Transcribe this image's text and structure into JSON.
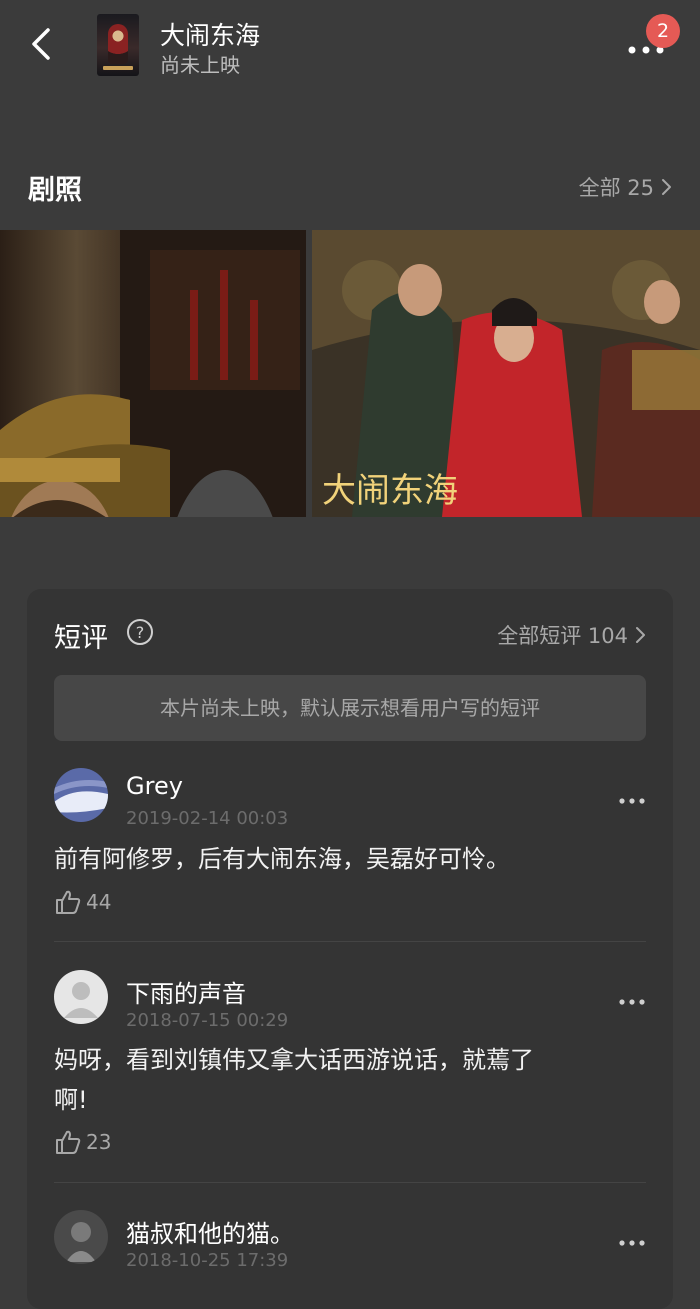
{
  "header": {
    "title": "大闹东海",
    "subtitle": "尚未上映",
    "badge": "2"
  },
  "stills": {
    "title": "剧照",
    "all_label": "全部 25",
    "logo_text": "大闹东海"
  },
  "short_reviews": {
    "title": "短评",
    "all_label": "全部短评 104",
    "notice": "本片尚未上映，默认展示想看用户写的短评",
    "items": [
      {
        "user": "Grey",
        "date": "2019-02-14 00:03",
        "text": "前有阿修罗，后有大闹东海，吴磊好可怜。",
        "likes": "44"
      },
      {
        "user": "下雨的声音",
        "date": "2018-07-15 00:29",
        "text_line1": "妈呀，看到刘镇伟又拿大话西游说话，就蔫了",
        "text_line2": "啊!",
        "likes": "23"
      },
      {
        "user": "猫叔和他的猫。",
        "date": "2018-10-25 17:39"
      }
    ]
  },
  "colors": {
    "background": "#3b3b3b",
    "card": "#343434",
    "badge": "#e55a55",
    "muted_text": "#a8a8a8"
  }
}
